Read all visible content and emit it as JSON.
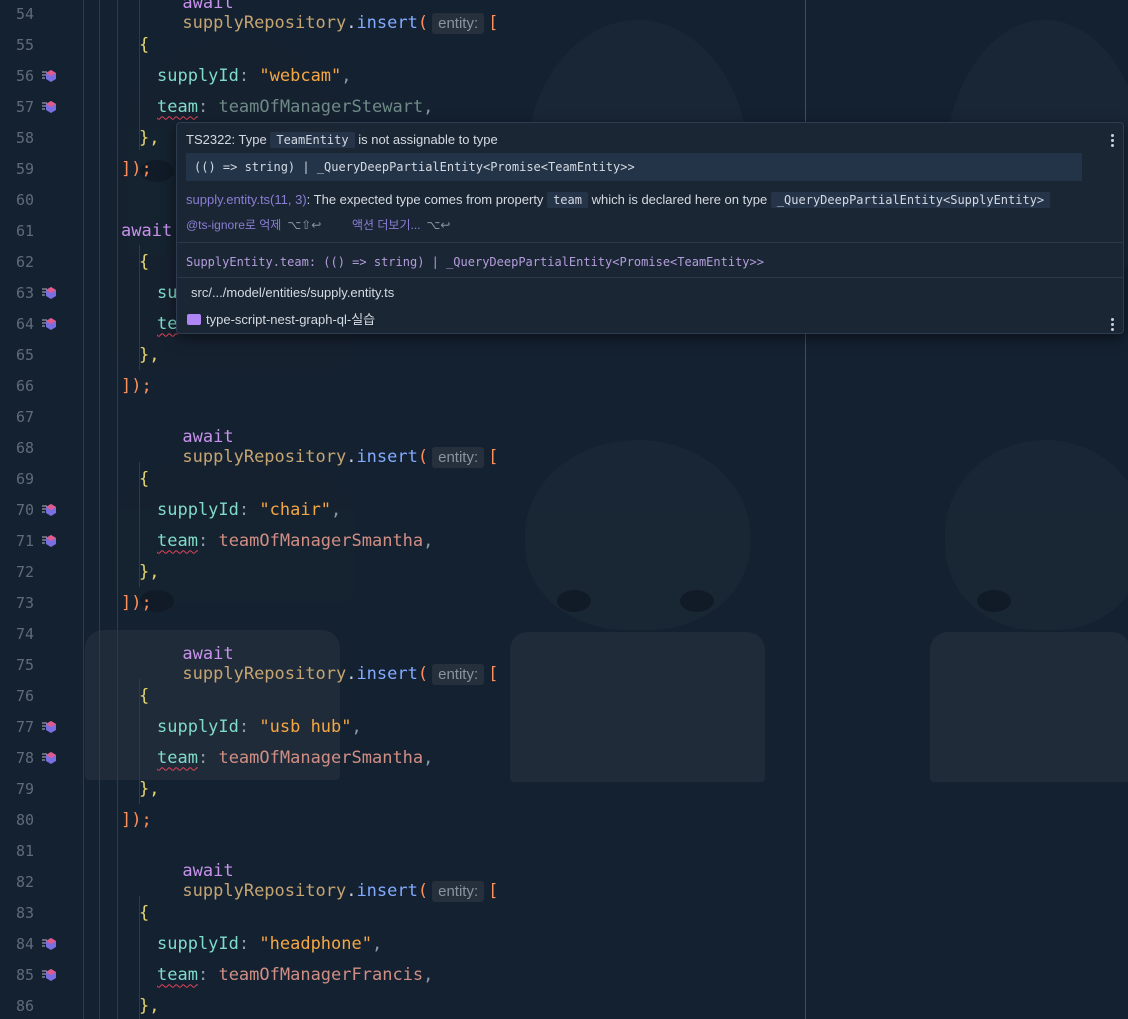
{
  "line_numbers": [
    "54",
    "55",
    "56",
    "57",
    "58",
    "59",
    "60",
    "61",
    "62",
    "63",
    "64",
    "65",
    "66",
    "67",
    "68",
    "69",
    "70",
    "71",
    "72",
    "73",
    "74",
    "75",
    "76",
    "77",
    "78",
    "79",
    "80",
    "81",
    "82",
    "83",
    "84",
    "85",
    "86"
  ],
  "code": {
    "await": "await",
    "repo": "supplyRepository",
    "dot": ".",
    "insert": "insert",
    "open_paren": "(",
    "hint": "entity:",
    "open_bracket": "[",
    "open_brace": "{",
    "close_brace": "},",
    "close": "]);",
    "supply_key": "supplyId",
    "team_key": "team",
    "colon": ":",
    "comma": ",",
    "hidden_su": "su",
    "hidden_te": "te",
    "blocks": [
      {
        "supply": "\"webcam\"",
        "team": "teamOfManagerStewart"
      },
      {
        "supply": "\"chair\"",
        "team": "teamOfManagerSmantha"
      },
      {
        "supply": "\"usb hub\"",
        "team": "teamOfManagerSmantha"
      },
      {
        "supply": "\"headphone\"",
        "team": "teamOfManagerFrancis"
      }
    ]
  },
  "popup": {
    "error_prefix": "TS2322: Type",
    "error_type": "TeamEntity",
    "error_suffix": "is not assignable to type",
    "type_line": "(() => string) | _QueryDeepPartialEntity<Promise<TeamEntity>>",
    "source_link": "supply.entity.ts(11, 3)",
    "source_text1": ": The expected type comes from property",
    "source_prop": "team",
    "source_text2": "which is declared here on type",
    "source_type": "_QueryDeepPartialEntity<SupplyEntity>",
    "action1": "@ts-ignore로 억제",
    "action1_kbd": "⌥⇧↩",
    "action2": "액션 더보기...",
    "action2_kbd": "⌥↩",
    "signature": "SupplyEntity.team: (() => string) | _QueryDeepPartialEntity<Promise<TeamEntity>>",
    "file_path": "src/.../model/entities/supply.entity.ts",
    "project": "type-script-nest-graph-ql-실습"
  }
}
